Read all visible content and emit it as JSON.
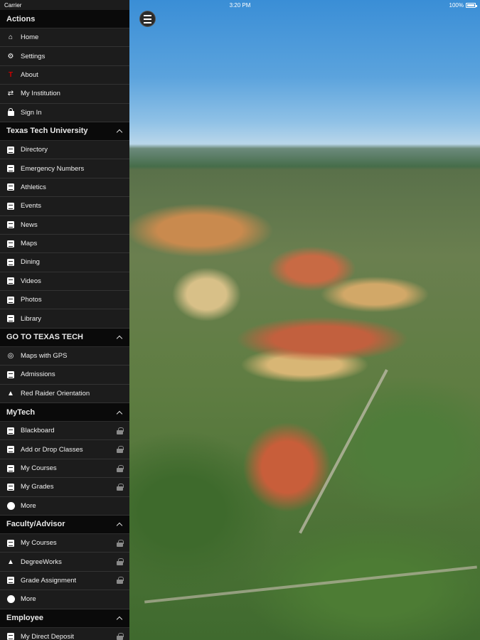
{
  "status_bar": {
    "carrier": "Carrier",
    "time": "3:20 PM",
    "battery": "100%"
  },
  "sidebar": {
    "sections": [
      {
        "title": "Actions",
        "collapsible": false,
        "items": [
          {
            "label": "Home",
            "icon": "home-icon",
            "locked": false
          },
          {
            "label": "Settings",
            "icon": "gear-icon",
            "locked": false
          },
          {
            "label": "About",
            "icon": "texas-tech-logo-icon",
            "locked": false
          },
          {
            "label": "My Institution",
            "icon": "swap-arrows-icon",
            "locked": false
          },
          {
            "label": "Sign In",
            "icon": "lock-icon",
            "locked": false
          }
        ]
      },
      {
        "title": "Texas Tech University",
        "collapsible": true,
        "items": [
          {
            "label": "Directory",
            "icon": "directory-icon",
            "locked": false
          },
          {
            "label": "Emergency Numbers",
            "icon": "emergency-icon",
            "locked": false
          },
          {
            "label": "Athletics",
            "icon": "athletics-icon",
            "locked": false
          },
          {
            "label": "Events",
            "icon": "calendar-icon",
            "locked": false
          },
          {
            "label": "News",
            "icon": "news-icon",
            "locked": false
          },
          {
            "label": "Maps",
            "icon": "map-icon",
            "locked": false
          },
          {
            "label": "Dining",
            "icon": "dining-icon",
            "locked": false
          },
          {
            "label": "Videos",
            "icon": "video-icon",
            "locked": false
          },
          {
            "label": "Photos",
            "icon": "photo-icon",
            "locked": false
          },
          {
            "label": "Library",
            "icon": "library-icon",
            "locked": false
          }
        ]
      },
      {
        "title": "GO TO TEXAS TECH",
        "collapsible": true,
        "items": [
          {
            "label": "Maps with GPS",
            "icon": "compass-icon",
            "locked": false
          },
          {
            "label": "Admissions",
            "icon": "admissions-icon",
            "locked": false
          },
          {
            "label": "Red Raider Orientation",
            "icon": "graduation-cap-icon",
            "locked": false
          }
        ]
      },
      {
        "title": "MyTech",
        "collapsible": true,
        "items": [
          {
            "label": "Blackboard",
            "icon": "book-icon",
            "locked": true
          },
          {
            "label": "Add or Drop Classes",
            "icon": "list-icon",
            "locked": true
          },
          {
            "label": "My Courses",
            "icon": "courses-icon",
            "locked": true
          },
          {
            "label": "My Grades",
            "icon": "grades-icon",
            "locked": true
          },
          {
            "label": "More",
            "icon": "more-icon",
            "locked": false
          }
        ]
      },
      {
        "title": "Faculty/Advisor",
        "collapsible": true,
        "items": [
          {
            "label": "My Courses",
            "icon": "courses-icon",
            "locked": true
          },
          {
            "label": "DegreeWorks",
            "icon": "graduation-cap-icon",
            "locked": true
          },
          {
            "label": "Grade Assignment",
            "icon": "book-icon",
            "locked": true
          },
          {
            "label": "More",
            "icon": "more-icon",
            "locked": false
          }
        ]
      },
      {
        "title": "Employee",
        "collapsible": true,
        "items": [
          {
            "label": "My Direct Deposit",
            "icon": "deposit-icon",
            "locked": true
          }
        ]
      }
    ]
  }
}
